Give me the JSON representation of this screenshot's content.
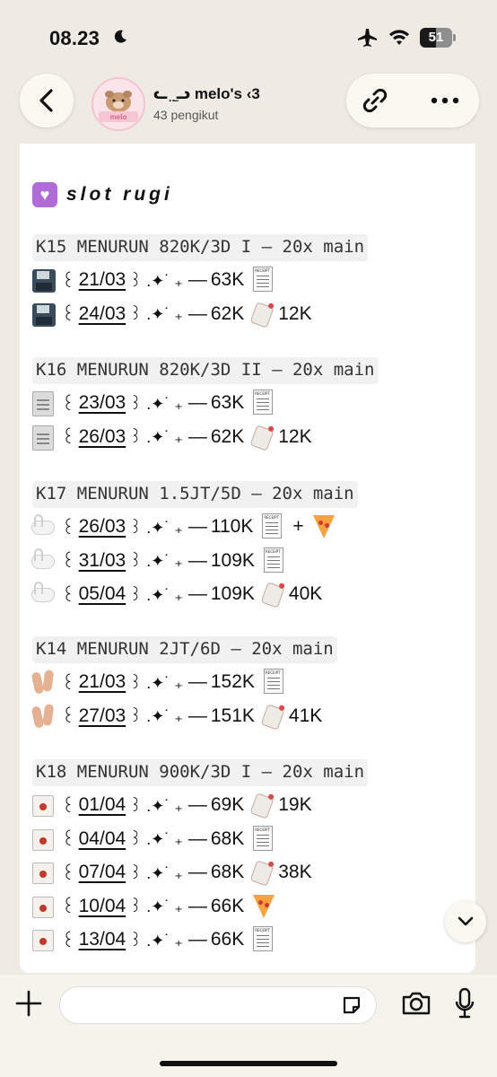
{
  "status_bar": {
    "time": "08.23",
    "battery_level": "51"
  },
  "header": {
    "channel_name": "ᓚ ̤ ̫ᓗ melo's ‹3",
    "followers": "43 pengikut",
    "avatar_label": "melo"
  },
  "message": {
    "section_title": "slot rugi",
    "groups": [
      {
        "title": "K15 MENURUN 820K/3D I – 20x main",
        "entries": [
          {
            "icon": "floppy-disk",
            "date": "21/03",
            "amount": "63K",
            "tag": "receipt",
            "extra": ""
          },
          {
            "icon": "floppy-disk",
            "date": "24/03",
            "amount": "62K",
            "tag": "price-tag",
            "extra": "12K"
          }
        ]
      },
      {
        "title": "K16 MENURUN 820K/3D II – 20x main",
        "entries": [
          {
            "icon": "document",
            "date": "23/03",
            "amount": "63K",
            "tag": "receipt",
            "extra": ""
          },
          {
            "icon": "document",
            "date": "26/03",
            "amount": "62K",
            "tag": "price-tag",
            "extra": "12K"
          }
        ]
      },
      {
        "title": "K17 MENURUN 1.5JT/5D – 20x main",
        "entries": [
          {
            "icon": "swan",
            "date": "26/03",
            "amount": "110K",
            "tag": "receipt",
            "extra": "+",
            "tag2": "pizza"
          },
          {
            "icon": "swan",
            "date": "31/03",
            "amount": "109K",
            "tag": "receipt",
            "extra": ""
          },
          {
            "icon": "swan",
            "date": "05/04",
            "amount": "109K",
            "tag": "price-tag",
            "extra": "40K"
          }
        ]
      },
      {
        "title": "K14 MENURUN 2JT/6D – 20x main",
        "entries": [
          {
            "icon": "feet",
            "date": "21/03",
            "amount": "152K",
            "tag": "receipt",
            "extra": ""
          },
          {
            "icon": "feet",
            "date": "27/03",
            "amount": "151K",
            "tag": "price-tag",
            "extra": "41K"
          }
        ]
      },
      {
        "title": "K18 MENURUN 900K/3D I – 20x main",
        "entries": [
          {
            "icon": "takeout-box",
            "date": "01/04",
            "amount": "69K",
            "tag": "price-tag",
            "extra": "19K"
          },
          {
            "icon": "takeout-box",
            "date": "04/04",
            "amount": "68K",
            "tag": "receipt",
            "extra": ""
          },
          {
            "icon": "takeout-box",
            "date": "07/04",
            "amount": "68K",
            "tag": "price-tag",
            "extra": "38K"
          },
          {
            "icon": "takeout-box",
            "date": "10/04",
            "amount": "66K",
            "tag": "pizza",
            "extra": ""
          },
          {
            "icon": "takeout-box",
            "date": "13/04",
            "amount": "66K",
            "tag": "receipt",
            "extra": ""
          }
        ]
      }
    ],
    "hook_glyph": "꒰",
    "deco_glyph": "꒱ .✦˙ ₊",
    "dash": "—"
  },
  "composer": {
    "input_value": "",
    "input_placeholder": ""
  }
}
